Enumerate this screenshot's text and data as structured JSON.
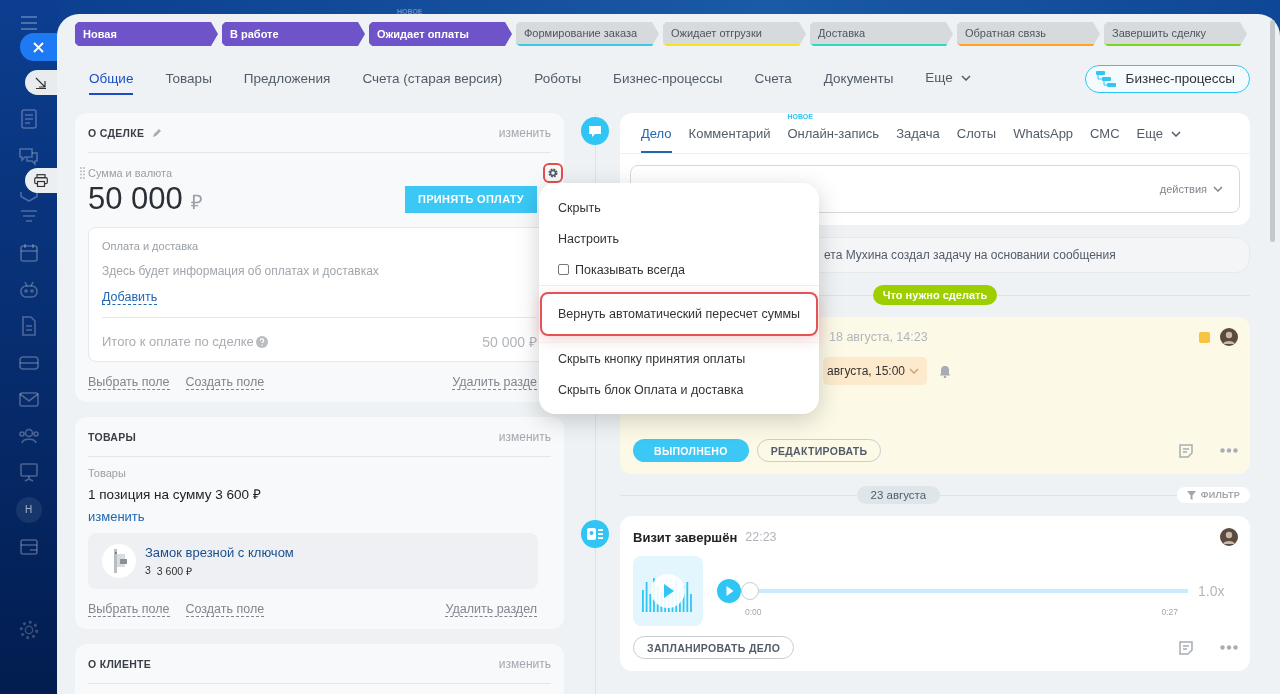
{
  "top_badge": "НОВОЕ",
  "sidebar_avatar": "Н",
  "stages": [
    {
      "label": "Новая",
      "selected": true,
      "color": "#6e53c9"
    },
    {
      "label": "В работе",
      "selected": true,
      "color": "#6e53c9"
    },
    {
      "label": "Ожидает оплаты",
      "selected": true,
      "color": "#6e53c9"
    },
    {
      "label": "Формирование заказа",
      "selected": false,
      "color": "#3fc6e0"
    },
    {
      "label": "Ожидает отгрузки",
      "selected": false,
      "color": "#f7e227"
    },
    {
      "label": "Доставка",
      "selected": false,
      "color": "#2fd9c0"
    },
    {
      "label": "Обратная связь",
      "selected": false,
      "color": "#ffa41c"
    },
    {
      "label": "Завершить сделку",
      "selected": false,
      "color": "#7bd41d"
    }
  ],
  "tabs": [
    {
      "label": "Общие",
      "selected": true
    },
    {
      "label": "Товары",
      "selected": false
    },
    {
      "label": "Предложения",
      "selected": false
    },
    {
      "label": "Счета (старая версия)",
      "selected": false
    },
    {
      "label": "Роботы",
      "selected": false
    },
    {
      "label": "Бизнес-процессы",
      "selected": false
    },
    {
      "label": "Счета",
      "selected": false
    },
    {
      "label": "Документы",
      "selected": false
    }
  ],
  "tabs_more": "Еще",
  "bp_button": "Бизнес-процессы",
  "deal_card": {
    "title": "О СДЕЛКЕ",
    "edit": "изменить",
    "field_label": "Сумма и валюта",
    "gear_highlighted": true,
    "amount": "50 000",
    "currency": "₽",
    "pay_button": "ПРИНЯТЬ ОПЛАТУ",
    "payment": {
      "title": "Оплата и доставка",
      "info": "Здесь будет информация об оплатах и доставках",
      "add": "Добавить",
      "total_label": "Итого к оплате по сделке",
      "total": "50 000 ₽"
    },
    "footer": [
      "Выбрать поле",
      "Создать поле"
    ],
    "delete": "Удалить разде"
  },
  "products_card": {
    "title": "ТОВАРЫ",
    "edit": "изменить",
    "label": "Товары",
    "summary": "1 позиция на сумму 3 600 ₽",
    "change": "изменить",
    "item": {
      "name": "Замок врезной с ключом",
      "qty": "3",
      "price": "3 600 ₽"
    },
    "footer": [
      "Выбрать поле",
      "Создать поле"
    ],
    "delete": "Удалить раздел"
  },
  "client_card": {
    "title": "О КЛИЕНТЕ",
    "edit": "изменить"
  },
  "composer": {
    "tabs": [
      {
        "label": "Дело",
        "selected": true
      },
      {
        "label": "Комментарий",
        "selected": false
      },
      {
        "label": "Онлайн-запись",
        "selected": false,
        "badge": "НОВОЕ"
      },
      {
        "label": "Задача",
        "selected": false
      },
      {
        "label": "Слоты",
        "selected": false
      },
      {
        "label": "WhatsApp",
        "selected": false
      },
      {
        "label": "СМС",
        "selected": false
      }
    ],
    "more": "Еще",
    "actions": "действия"
  },
  "history_note": "ета Мухина создал задачу на основании сообщения",
  "todo_label": "Что нужно сделать",
  "task": {
    "time": "18 августа, 14:23",
    "deadline": "августа, 15:00",
    "done": "ВЫПОЛНЕНО",
    "edit": "РЕДАКТИРОВАТЬ"
  },
  "date_divider": "23 августа",
  "filter": "ФИЛЬТР",
  "visit": {
    "title": "Визит завершён",
    "time": "22:23",
    "player": {
      "level": 0,
      "start": "0:00",
      "end": "0:27",
      "speed": "1.0x"
    },
    "button": "ЗАПЛАНИРОВАТЬ ДЕЛО"
  },
  "menu": {
    "items": [
      {
        "kind": "item",
        "label": "Скрыть",
        "highlighted": false
      },
      {
        "kind": "item",
        "label": "Настроить",
        "highlighted": false
      },
      {
        "kind": "checkbox",
        "label": "Показывать всегда",
        "checked": false,
        "highlighted": false
      },
      {
        "kind": "item",
        "label": "Вернуть автоматический пересчет суммы",
        "highlighted": true
      },
      {
        "kind": "item",
        "label": "Скрыть кнопку принятия оплаты",
        "highlighted": false
      },
      {
        "kind": "item",
        "label": "Скрыть блок Оплата и доставка",
        "highlighted": false
      }
    ]
  }
}
